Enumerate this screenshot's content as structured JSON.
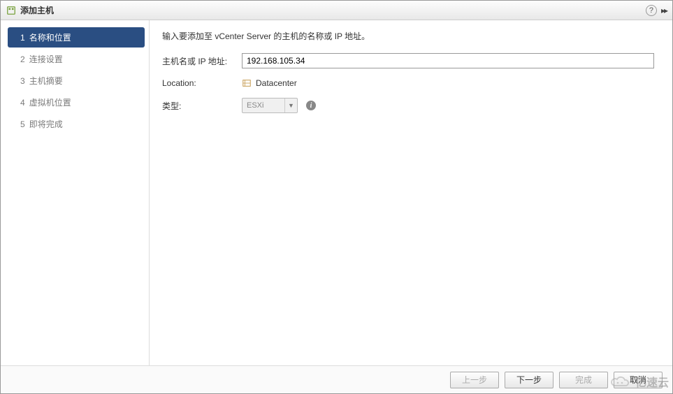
{
  "window": {
    "title": "添加主机"
  },
  "sidebar": {
    "steps": [
      {
        "num": "1",
        "label": "名称和位置",
        "active": true
      },
      {
        "num": "2",
        "label": "连接设置",
        "active": false
      },
      {
        "num": "3",
        "label": "主机摘要",
        "active": false
      },
      {
        "num": "4",
        "label": "虚拟机位置",
        "active": false
      },
      {
        "num": "5",
        "label": "即将完成",
        "active": false
      }
    ]
  },
  "form": {
    "description": "输入要添加至 vCenter Server 的主机的名称或 IP 地址。",
    "host_label": "主机名或 IP 地址:",
    "host_value": "192.168.105.34",
    "location_label": "Location:",
    "location_value": "Datacenter",
    "type_label": "类型:",
    "type_value": "ESXi"
  },
  "footer": {
    "back_label": "上一步",
    "next_label": "下一步",
    "finish_label": "完成",
    "cancel_label": "取消"
  },
  "watermark": {
    "text": "亿速云"
  }
}
